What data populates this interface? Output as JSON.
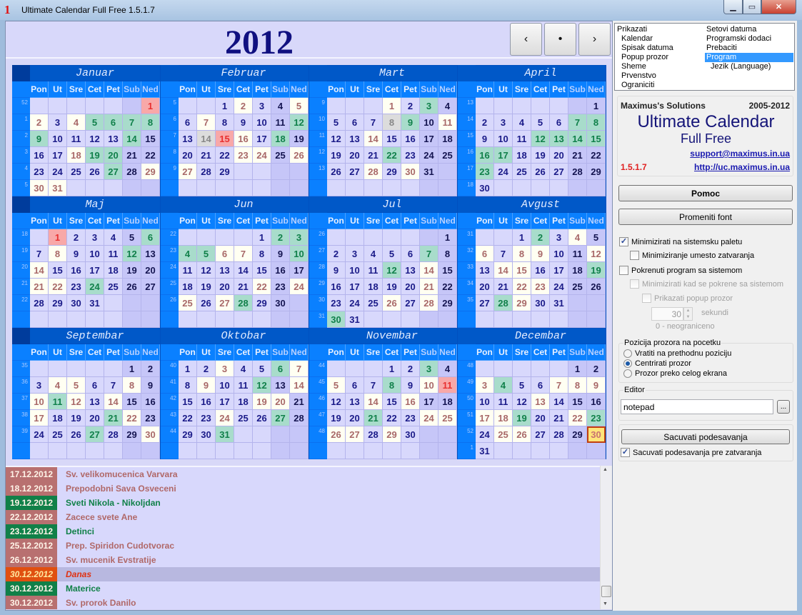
{
  "window": {
    "title": "Ultimate Calendar Full Free 1.5.1.7",
    "icon_glyph": "1"
  },
  "header": {
    "year": "2012",
    "prev_label": "‹",
    "today_label": "•",
    "next_label": "›"
  },
  "calendar": {
    "year": 2012,
    "weekdays": [
      "Pon",
      "Ut",
      "Sre",
      "Cet",
      "Pet",
      "Sub",
      "Ned"
    ],
    "months": [
      {
        "name": "Januar",
        "weeks": [
          "52",
          "1",
          "2",
          "3",
          "4",
          "5"
        ],
        "r": [
          1
        ],
        "c": [
          2,
          4,
          18,
          29,
          30,
          31
        ],
        "g": [
          5,
          6,
          7,
          8,
          9,
          14,
          19,
          20,
          27
        ]
      },
      {
        "name": "Februar",
        "weeks": [
          "5",
          "6",
          "7",
          "8",
          "9",
          ""
        ],
        "c": [
          2,
          5,
          7,
          16,
          23,
          24,
          26,
          27
        ],
        "g": [
          12,
          18
        ],
        "x": [
          14
        ],
        "r": [
          15
        ]
      },
      {
        "name": "Mart",
        "weeks": [
          "9",
          "10",
          "11",
          "12",
          "13",
          ""
        ],
        "c": [
          1,
          11,
          14,
          28,
          30
        ],
        "g": [
          3,
          9,
          22
        ],
        "x": [
          8
        ]
      },
      {
        "name": "April",
        "weeks": [
          "13",
          "14",
          "15",
          "16",
          "17",
          "18"
        ],
        "g": [
          7,
          8,
          12,
          13,
          14,
          15,
          16,
          17,
          23
        ]
      },
      {
        "name": "Maj",
        "weeks": [
          "18",
          "19",
          "20",
          "21",
          "22",
          ""
        ],
        "r": [
          1
        ],
        "g": [
          6,
          12,
          24
        ],
        "c": [
          8,
          14,
          21,
          22
        ]
      },
      {
        "name": "Jun",
        "weeks": [
          "22",
          "23",
          "24",
          "25",
          "26",
          ""
        ],
        "g": [
          2,
          3,
          4,
          5,
          10,
          28
        ],
        "c": [
          6,
          7,
          22,
          24,
          25,
          27
        ]
      },
      {
        "name": "Jul",
        "weeks": [
          "26",
          "27",
          "28",
          "29",
          "30",
          "31"
        ],
        "g": [
          7,
          12,
          30
        ],
        "c": [
          14,
          21,
          26,
          28
        ]
      },
      {
        "name": "Avgust",
        "weeks": [
          "31",
          "32",
          "33",
          "34",
          "35",
          ""
        ],
        "g": [
          2,
          19,
          28
        ],
        "c": [
          4,
          6,
          8,
          9,
          12,
          14,
          15,
          22,
          23,
          29
        ]
      },
      {
        "name": "Septembar",
        "weeks": [
          "35",
          "36",
          "37",
          "38",
          "39",
          ""
        ],
        "c": [
          4,
          5,
          8,
          10,
          12,
          14,
          17,
          22,
          30
        ],
        "g": [
          11,
          21,
          27
        ]
      },
      {
        "name": "Oktobar",
        "weeks": [
          "40",
          "41",
          "42",
          "43",
          "44",
          ""
        ],
        "c": [
          3,
          7,
          9,
          14,
          19,
          20,
          24
        ],
        "g": [
          6,
          12,
          27,
          31
        ]
      },
      {
        "name": "Novembar",
        "weeks": [
          "44",
          "45",
          "46",
          "47",
          "48",
          ""
        ],
        "g": [
          3,
          8,
          21
        ],
        "c": [
          5,
          10,
          14,
          16,
          24,
          25,
          26,
          27,
          29
        ],
        "r": [
          11
        ]
      },
      {
        "name": "Decembar",
        "weeks": [
          "48",
          "49",
          "50",
          "51",
          "52",
          "1"
        ],
        "c": [
          3,
          7,
          8,
          9,
          13,
          17,
          18,
          22,
          25,
          26
        ],
        "g": [
          4,
          19,
          23
        ],
        "t": [
          30
        ]
      }
    ]
  },
  "events": [
    {
      "date": "17.12.2012",
      "text": "Sv. velikomucenica Varvara",
      "kind": "church"
    },
    {
      "date": "18.12.2012",
      "text": "Prepodobni Sava Osveceni",
      "kind": "church"
    },
    {
      "date": "19.12.2012",
      "text": "Sveti Nikola - Nikoljdan",
      "kind": "holiday"
    },
    {
      "date": "22.12.2012",
      "text": "Zacece svete Ane",
      "kind": "church"
    },
    {
      "date": "23.12.2012",
      "text": "Detinci",
      "kind": "holiday"
    },
    {
      "date": "25.12.2012",
      "text": "Prep. Spiridon Cudotvorac",
      "kind": "church"
    },
    {
      "date": "26.12.2012",
      "text": "Sv. mucenik Evstratije",
      "kind": "church"
    },
    {
      "date": "30.12.2012",
      "text": "Danas",
      "kind": "today"
    },
    {
      "date": "30.12.2012",
      "text": "Materice",
      "kind": "holiday"
    },
    {
      "date": "30.12.2012",
      "text": "Sv. prorok Danilo",
      "kind": "church"
    }
  ],
  "colors": {
    "church_bg": "#b87070",
    "church_fg": "#b06868",
    "holiday_bg": "#108048",
    "holiday_fg": "#108048",
    "today_bg": "#e05010",
    "today_fg": "#e03010"
  },
  "tree": {
    "left": [
      "Prikazati",
      "Kalendar",
      "Spisak datuma",
      "Popup prozor",
      "Sheme",
      "Prvenstvo",
      "Ograniciti"
    ],
    "right": [
      "Setovi datuma",
      "Programski dodaci",
      "Prebaciti",
      "Program",
      "Jezik (Language)"
    ],
    "selected": "Program"
  },
  "info": {
    "company": "Maximus's Solutions",
    "years": "2005-2012",
    "product": "Ultimate Calendar",
    "edition": "Full Free",
    "email": "support@maximus.in.ua",
    "version": "1.5.1.7",
    "url": "http://uc.maximus.in.ua"
  },
  "settings": {
    "help_button": "Pomoc",
    "font_button": "Promeniti font",
    "minimize_tray": {
      "label": "Minimizirati na sistemsku paletu",
      "checked": true
    },
    "minimize_instead_close": {
      "label": "Minimiziranje umesto zatvaranja",
      "checked": false
    },
    "autostart": {
      "label": "Pokrenuti program sa sistemom",
      "checked": false
    },
    "minimize_on_start": {
      "label": "Minimizirati kad se pokrene sa sistemom",
      "checked": false
    },
    "show_popup": {
      "label": "Prikazati popup prozor",
      "checked": false
    },
    "seconds_value": "30",
    "seconds_label": "sekundi",
    "unlimited_hint": "0 - neograniceno",
    "position_group": "Pozicija prozora na pocetku",
    "position_options": [
      "Vratiti na prethodnu poziciju",
      "Centrirati prozor",
      "Prozor preko celog ekrana"
    ],
    "position_selected": 1,
    "editor_group": "Editor",
    "editor_value": "notepad",
    "browse_label": "...",
    "save_button": "Sacuvati podesavanja",
    "save_on_close": {
      "label": "Sacuvati podesavanja pre zatvaranja",
      "checked": true
    }
  }
}
